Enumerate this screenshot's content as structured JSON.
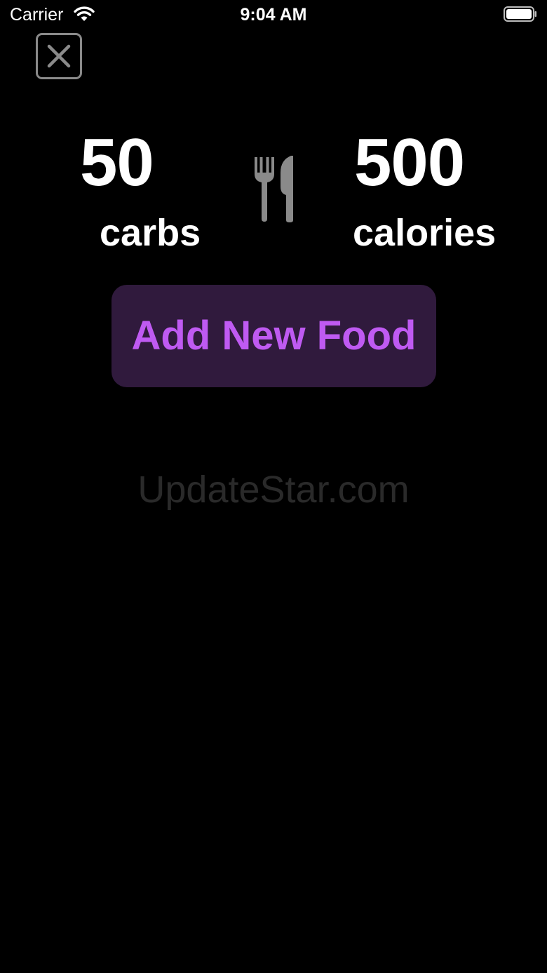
{
  "status_bar": {
    "carrier": "Carrier",
    "time": "9:04 AM",
    "wifi_icon": "wifi-icon",
    "battery_icon": "battery-icon"
  },
  "close": {
    "icon": "close-icon"
  },
  "stats": {
    "carbs_value": "50",
    "carbs_label": "carbs",
    "calories_value": "500",
    "calories_label": "calories",
    "icon": "fork-knife-icon"
  },
  "actions": {
    "add_food_label": "Add New Food"
  },
  "watermark": {
    "text": "UpdateStar.com"
  },
  "colors": {
    "background": "#000000",
    "accent": "#bf5af2",
    "button_background": "#301a3d",
    "icon_gray": "#8a8a8a"
  }
}
